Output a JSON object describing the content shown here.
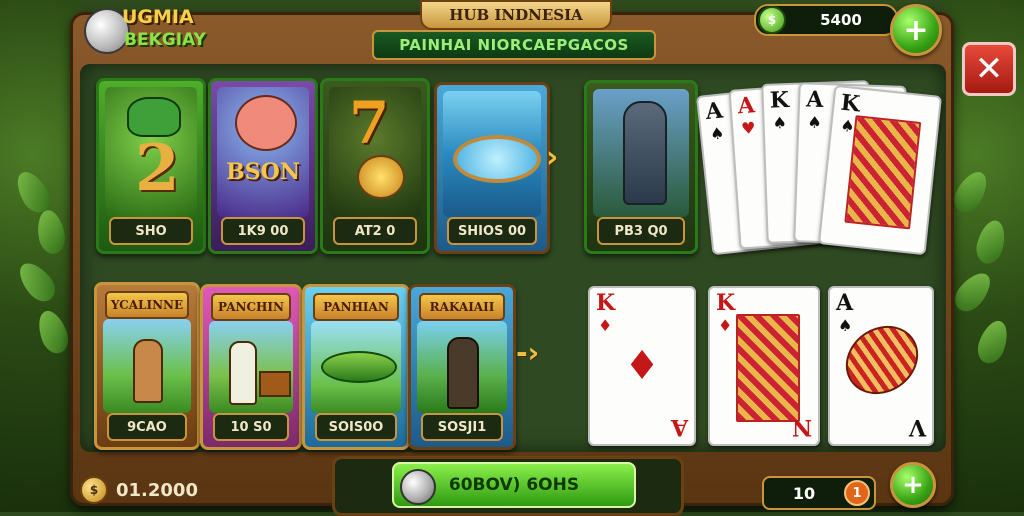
{
  "header": {
    "logo_line1": "UGMIA",
    "logo_line2": "BEKGIAY",
    "title": "HUB INDNESIA",
    "subtitle": "PAINHAI NIORCAEPGACOS",
    "balance": "5400",
    "balance_icon": "coin-icon",
    "add_icon": "plus-icon",
    "close_icon": "close-icon"
  },
  "games_row1": [
    {
      "label": "SHO",
      "theme": "dragon-two"
    },
    {
      "label": "1K9 00",
      "theme": "bison"
    },
    {
      "label": "AT2 0",
      "theme": "golden-seven"
    },
    {
      "label": "SHIOS 00",
      "theme": "fountain"
    }
  ],
  "featured": {
    "label": "PB3 Q0",
    "theme": "knight"
  },
  "games_row2": [
    {
      "banner": "YCALINNE",
      "label": "9CAO",
      "theme": "fisherman"
    },
    {
      "banner": "PANCHIN",
      "label": "10 S0",
      "theme": "treasure-hunter"
    },
    {
      "banner": "PANHIAN",
      "label": "SOIS0O",
      "theme": "fish"
    },
    {
      "banner": "RAKAIAII",
      "label": "SOSJI1",
      "theme": "hunter"
    }
  ],
  "cards_fan": [
    {
      "rank": "A",
      "suit": "♠",
      "color": "black"
    },
    {
      "rank": "A",
      "suit": "♥",
      "color": "red"
    },
    {
      "rank": "K",
      "suit": "♠",
      "color": "black"
    },
    {
      "rank": "A",
      "suit": "♠",
      "color": "black"
    },
    {
      "rank": "K",
      "suit": "♠",
      "color": "black"
    }
  ],
  "cards_row": [
    {
      "rank": "K",
      "suit": "♦",
      "color": "red",
      "bottom": "A"
    },
    {
      "rank": "K",
      "suit": "♦",
      "color": "red",
      "bottom": "N"
    },
    {
      "rank": "A",
      "suit": "♠",
      "color": "black",
      "bottom": "V"
    }
  ],
  "footer": {
    "left_balance": "01.2000",
    "play_button": "60BOV) 6OHS",
    "bet_value": "10",
    "bet_info": "1"
  }
}
